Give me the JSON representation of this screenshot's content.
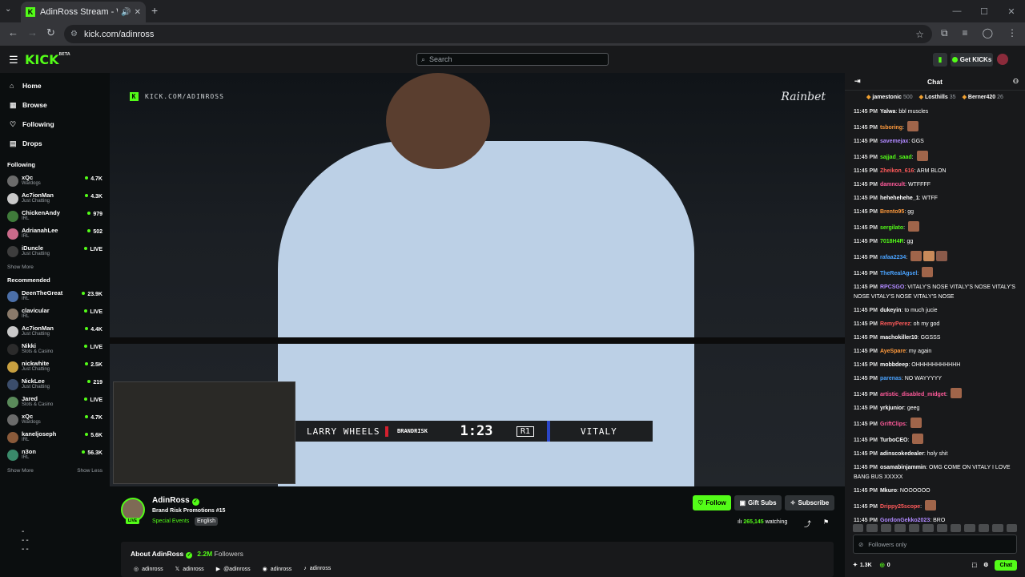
{
  "browser": {
    "tab_title": "AdinRoss Stream - Watch Li",
    "url": "kick.com/adinross"
  },
  "header": {
    "logo": "KICK",
    "logo_sup": "BETA",
    "search_placeholder": "Search",
    "get_kicks": "Get KICKs"
  },
  "sidebar": {
    "nav": [
      {
        "label": "Home",
        "icon": "home-icon"
      },
      {
        "label": "Browse",
        "icon": "browse-icon"
      },
      {
        "label": "Following",
        "icon": "heart-icon"
      },
      {
        "label": "Drops",
        "icon": "drops-icon"
      }
    ],
    "following_title": "Following",
    "following": [
      {
        "name": "xQc",
        "category": "Wardogs",
        "viewers": "4.7K",
        "color": "#6b6b6b"
      },
      {
        "name": "Ac7ionMan",
        "category": "Just Chatting",
        "viewers": "4.3K",
        "color": "#c9c9c9"
      },
      {
        "name": "ChickenAndy",
        "category": "IRL",
        "viewers": "979",
        "color": "#3f7b3a"
      },
      {
        "name": "AdrianahLee",
        "category": "IRL",
        "viewers": "502",
        "color": "#c96a8a"
      },
      {
        "name": "iDuncle",
        "category": "Just Chatting",
        "viewers": "LIVE",
        "color": "#3d3d3d"
      }
    ],
    "show_more": "Show More",
    "recommended_title": "Recommended",
    "recommended": [
      {
        "name": "DeenTheGreat",
        "category": "IRL",
        "viewers": "23.9K",
        "color": "#4b6fa8"
      },
      {
        "name": "clavicular",
        "category": "IRL",
        "viewers": "LIVE",
        "color": "#8a7a6a"
      },
      {
        "name": "Ac7ionMan",
        "category": "Just Chatting",
        "viewers": "4.4K",
        "color": "#c9c9c9"
      },
      {
        "name": "Nikki",
        "category": "Slots & Casino",
        "viewers": "LIVE",
        "color": "#2b2b2b"
      },
      {
        "name": "nickwhite",
        "category": "Just Chatting",
        "viewers": "2.5K",
        "color": "#c8a040"
      },
      {
        "name": "NickLee",
        "category": "Just Chatting",
        "viewers": "219",
        "color": "#3b4d6b"
      },
      {
        "name": "Jared",
        "category": "Slots & Casino",
        "viewers": "LIVE",
        "color": "#5a8a5a"
      },
      {
        "name": "xQc",
        "category": "Wardogs",
        "viewers": "4.7K",
        "color": "#6b6b6b"
      },
      {
        "name": "kaneljoseph",
        "category": "IRL",
        "viewers": "5.6K",
        "color": "#8a5a3a"
      },
      {
        "name": "n3on",
        "category": "IRL",
        "viewers": "56.3K",
        "color": "#3a8a6a"
      }
    ],
    "show_more_2": "Show More",
    "show_less": "Show Less"
  },
  "video": {
    "watermark": "KICK.COM/ADINROSS",
    "sponsor": "Rainbet",
    "fighter1": "LARRY WHEELS",
    "promo": "BRANDRISK",
    "clock": "1:23",
    "round": "R1",
    "fighter2": "VITALY"
  },
  "stream": {
    "name": "AdinRoss",
    "live": "LIVE",
    "title": "Brand Risk Promotions #15",
    "category": "Special Events",
    "language": "English",
    "follow": "Follow",
    "gift": "Gift Subs",
    "subscribe": "Subscribe",
    "viewers": "265,145",
    "viewers_label": "watching",
    "about_prefix": "About AdinRoss",
    "followers": "2.2M",
    "followers_label": "Followers",
    "socials": [
      {
        "icon": "instagram-icon",
        "glyph": "◎",
        "handle": "adinross"
      },
      {
        "icon": "x-icon",
        "glyph": "𝕏",
        "handle": "adinross"
      },
      {
        "icon": "youtube-icon",
        "glyph": "▶",
        "handle": "@adinross"
      },
      {
        "icon": "discord-icon",
        "glyph": "◉",
        "handle": "adinross"
      },
      {
        "icon": "tiktok-icon",
        "glyph": "♪",
        "handle": "adinross"
      }
    ]
  },
  "chat": {
    "title": "Chat",
    "leaders": [
      {
        "name": "jamestonic",
        "count": "500"
      },
      {
        "name": "Losthills",
        "count": "35"
      },
      {
        "name": "Berner420",
        "count": "26"
      }
    ],
    "messages": [
      {
        "time": "11:45 PM",
        "user": "Yalwa",
        "color": "#ffffff",
        "text": "bbl muscles",
        "emotes": 0
      },
      {
        "time": "11:45 PM",
        "user": "tsboring",
        "color": "#ff9a3c",
        "text": "",
        "emotes": 1
      },
      {
        "time": "11:45 PM",
        "user": "savemejax",
        "color": "#b089ff",
        "text": "GGS",
        "emotes": 0
      },
      {
        "time": "11:45 PM",
        "user": "sajjad_saad",
        "color": "#53fc18",
        "text": "",
        "emotes": 1
      },
      {
        "time": "11:45 PM",
        "user": "Zheikon_616",
        "color": "#ff5a5a",
        "text": "ARM BLON",
        "emotes": 0
      },
      {
        "time": "11:45 PM",
        "user": "damncult",
        "color": "#ff5a9a",
        "text": "WTFFFF",
        "emotes": 0
      },
      {
        "time": "11:45 PM",
        "user": "hehehehehe_1",
        "color": "#ffffff",
        "text": "WTFF",
        "emotes": 0
      },
      {
        "time": "11:45 PM",
        "user": "Brento95",
        "color": "#ff9a3c",
        "text": "gg",
        "emotes": 0
      },
      {
        "time": "11:45 PM",
        "user": "sergilato",
        "color": "#53fc18",
        "text": "",
        "emotes": 1
      },
      {
        "time": "11:45 PM",
        "user": "7018H4R",
        "color": "#53fc18",
        "text": "gg",
        "emotes": 0
      },
      {
        "time": "11:45 PM",
        "user": "rafaa2234",
        "color": "#4aa3ff",
        "text": "",
        "emotes": 3
      },
      {
        "time": "11:45 PM",
        "user": "TheRealAgsel",
        "color": "#4aa3ff",
        "text": "",
        "emotes": 1
      },
      {
        "time": "11:45 PM",
        "user": "RPCSGO",
        "color": "#b089ff",
        "text": "VITALY'S NOSE VITALY'S NOSE VITALY'S NOSE VITALY'S NOSE VITALY'S NOSE",
        "emotes": 0
      },
      {
        "time": "11:45 PM",
        "user": "dukeyin",
        "color": "#ffffff",
        "text": "to much jucie",
        "emotes": 0
      },
      {
        "time": "11:45 PM",
        "user": "RemyPerez",
        "color": "#ff5a5a",
        "text": "oh my god",
        "emotes": 0
      },
      {
        "time": "11:45 PM",
        "user": "machokiller10",
        "color": "#ffffff",
        "text": "GGSSS",
        "emotes": 0
      },
      {
        "time": "11:45 PM",
        "user": "AyeSpare",
        "color": "#ff9a3c",
        "text": "my again",
        "emotes": 0
      },
      {
        "time": "11:45 PM",
        "user": "mobbdeep",
        "color": "#ffffff",
        "text": "OHHHHHHHHHHH",
        "emotes": 0
      },
      {
        "time": "11:45 PM",
        "user": "parenas",
        "color": "#4aa3ff",
        "text": "NO WAYYYYY",
        "emotes": 0
      },
      {
        "time": "11:45 PM",
        "user": "artistic_disabled_midget",
        "color": "#ff5a9a",
        "text": "",
        "emotes": 1
      },
      {
        "time": "11:45 PM",
        "user": "yrkjunior",
        "color": "#ffffff",
        "text": "geeg",
        "emotes": 0
      },
      {
        "time": "11:45 PM",
        "user": "GriftClips",
        "color": "#ff5a9a",
        "text": "",
        "emotes": 1
      },
      {
        "time": "11:45 PM",
        "user": "TurboCEO",
        "color": "#ffffff",
        "text": "",
        "emotes": 1
      },
      {
        "time": "11:45 PM",
        "user": "adinscokedealer",
        "color": "#ffffff",
        "text": "holy shit",
        "emotes": 0
      },
      {
        "time": "11:45 PM",
        "user": "osamabinjammin",
        "color": "#ffffff",
        "text": "OMG COME ON VITALY I LOVE BANG BUS XXXXX",
        "emotes": 0
      },
      {
        "time": "11:45 PM",
        "user": "Mkuro",
        "color": "#ffffff",
        "text": "NOOOOOO",
        "emotes": 0
      },
      {
        "time": "11:45 PM",
        "user": "Drippy25scope",
        "color": "#ff5a5a",
        "text": "",
        "emotes": 1
      },
      {
        "time": "11:45 PM",
        "user": "GordonGekko2023",
        "color": "#b089ff",
        "text": "BRO",
        "emotes": 0
      }
    ],
    "input_placeholder": "Followers only",
    "stat1": "1.3K",
    "stat2": "0",
    "chat_button": "Chat"
  },
  "colors": {
    "accent": "#53fc18"
  }
}
